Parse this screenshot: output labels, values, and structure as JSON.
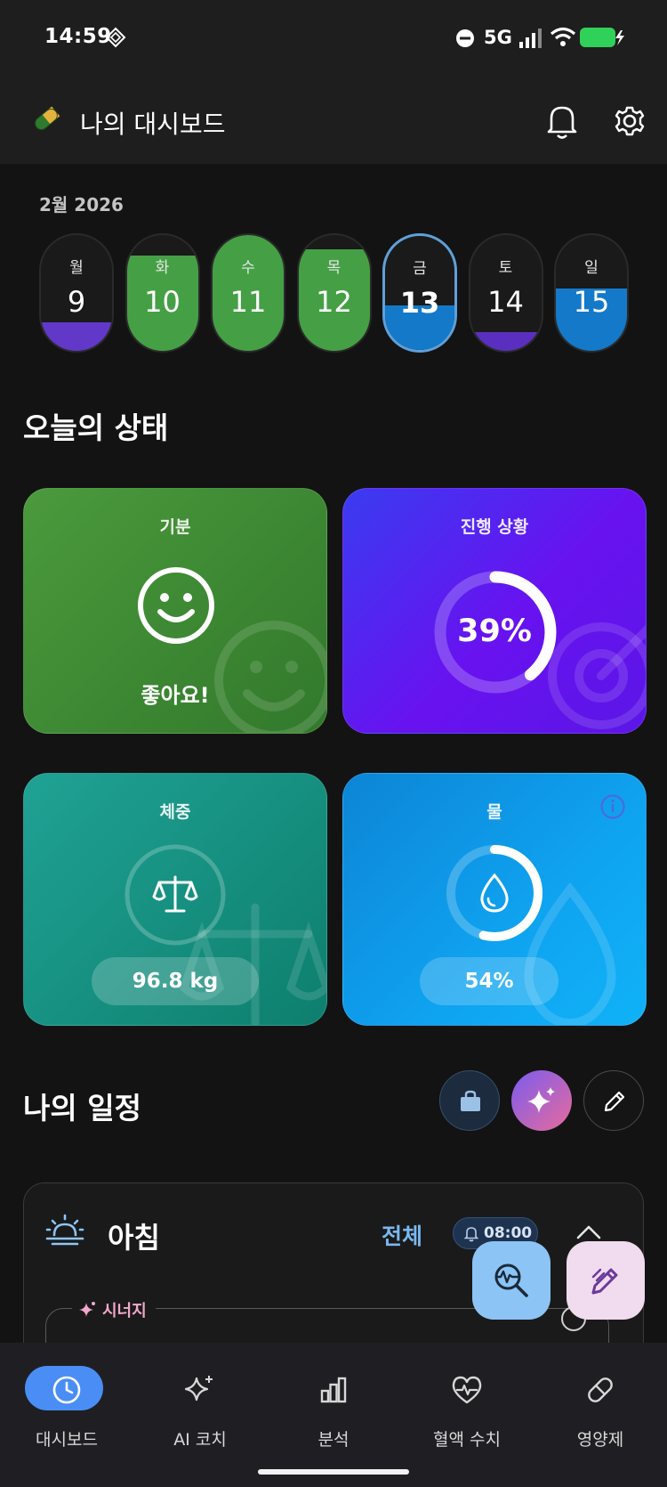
{
  "status_bar": {
    "time": "14:59",
    "network": "5G"
  },
  "app_bar": {
    "title": "나의 대시보드"
  },
  "calendar": {
    "month_label": "2월 2026",
    "days": [
      {
        "weekday": "월",
        "date": "9",
        "fill": 0.25
      },
      {
        "weekday": "화",
        "date": "10",
        "fill": 0.82
      },
      {
        "weekday": "수",
        "date": "11",
        "fill": 1.0
      },
      {
        "weekday": "목",
        "date": "12",
        "fill": 0.88
      },
      {
        "weekday": "금",
        "date": "13",
        "fill": 0.39,
        "today": true
      },
      {
        "weekday": "토",
        "date": "14",
        "fill": 0.16
      },
      {
        "weekday": "일",
        "date": "15",
        "fill": 0.54
      }
    ]
  },
  "today_status": {
    "title": "오늘의 상태",
    "mood": {
      "label": "기분",
      "value": "좋아요!"
    },
    "progress": {
      "label": "진행 상황",
      "value": "39%",
      "fraction": 0.39
    },
    "weight": {
      "label": "체중",
      "value": "96.8 kg"
    },
    "water": {
      "label": "물",
      "value": "54%",
      "fraction": 0.54
    }
  },
  "schedule": {
    "title": "나의 일정",
    "morning": {
      "label": "아침",
      "all_label": "전체",
      "alarm_time": "08:00",
      "synergy_label": "시너지"
    }
  },
  "bottom_nav": {
    "items": [
      {
        "label": "대시보드",
        "icon": "clock-icon",
        "active": true
      },
      {
        "label": "AI 코치",
        "icon": "sparkles-icon"
      },
      {
        "label": "분석",
        "icon": "bar-chart-icon"
      },
      {
        "label": "혈액 수치",
        "icon": "heart-pulse-icon"
      },
      {
        "label": "영양제",
        "icon": "pill-icon"
      }
    ]
  },
  "colors": {
    "mood_card": "#3f8a36",
    "progress_card": "#5b18ee",
    "weight_card": "#148c7e",
    "water_card": "#0d9be8",
    "nav_active": "#4a8ef5"
  }
}
